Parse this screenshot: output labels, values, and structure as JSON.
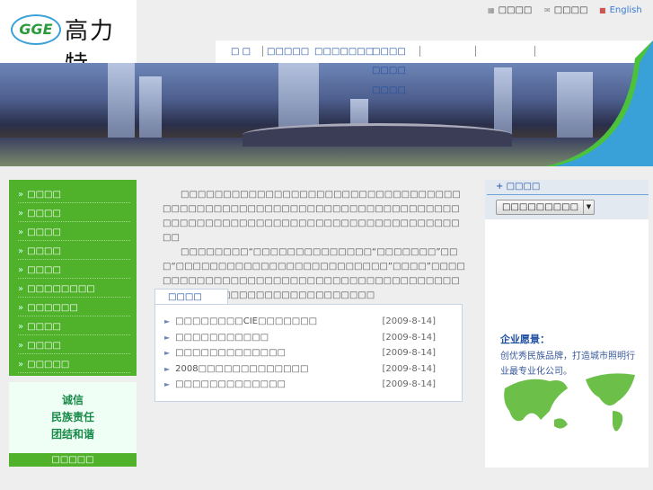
{
  "logo": {
    "mark": "GGE",
    "name": "高力特"
  },
  "toplinks": [
    {
      "icon": "sitemap-icon",
      "label": "□□□□"
    },
    {
      "icon": "mail-icon",
      "label": "□□□□"
    },
    {
      "icon": "flag-icon",
      "label": "English"
    }
  ],
  "nav": {
    "items": [
      "□ □",
      "□□□□□",
      "□□□□□□□",
      "□□□□"
    ],
    "dropdown": [
      "□□□□",
      "□□□□"
    ]
  },
  "leftnav": [
    "□□□□",
    "□□□□",
    "□□□□",
    "□□□□",
    "□□□□",
    "□□□□□□□□",
    "□□□□□□",
    "□□□□",
    "□□□□",
    "□□□□□"
  ],
  "slogan": [
    "诚信",
    "民族责任",
    "团结和谐"
  ],
  "footer": "□□□□□",
  "intro": [
    "□□□□□□□□□□□□□□□□□□□□□□□□□□□□□□□□□□□□□□□□□□□□□□□□□□□□□□□□□□□□□□□□□□□□□□□□□□□□□□□□□□□□□□□□□□□□□□□□□□□□□□□□□",
    "□□□□□□□□“□□□□□□□□□□□□□□“□□□□□□□”□□□“□□□□□□□□□□□□□□□□□□□□□□□□□”□□□□”□□□□□□□□□□□□□□□□□□□□□□□□□□□□□□□□□□□□□□□□□□□□□□□□□□□□□□□□□□□□□□□□"
  ],
  "news": {
    "tab": "□□□□",
    "items": [
      {
        "title": "□□□□□□□□CIE□□□□□□□",
        "date": "[2009-8-14]"
      },
      {
        "title": "□□□□□□□□□□□",
        "date": "[2009-8-14]"
      },
      {
        "title": "□□□□□□□□□□□□□",
        "date": "[2009-8-14]"
      },
      {
        "title": "2008□□□□□□□□□□□□□",
        "date": "[2009-8-14]"
      },
      {
        "title": "□□□□□□□□□□□□□",
        "date": "[2009-8-14]"
      }
    ]
  },
  "right": {
    "title": "□□□□",
    "select": "□□□□□□□□□",
    "vision_title": "企业愿景：",
    "vision_text": "创优秀民族品牌，打造城市照明行业最专业化公司。"
  },
  "colors": {
    "green": "#4fb22a",
    "blue": "#1f4fa0"
  }
}
